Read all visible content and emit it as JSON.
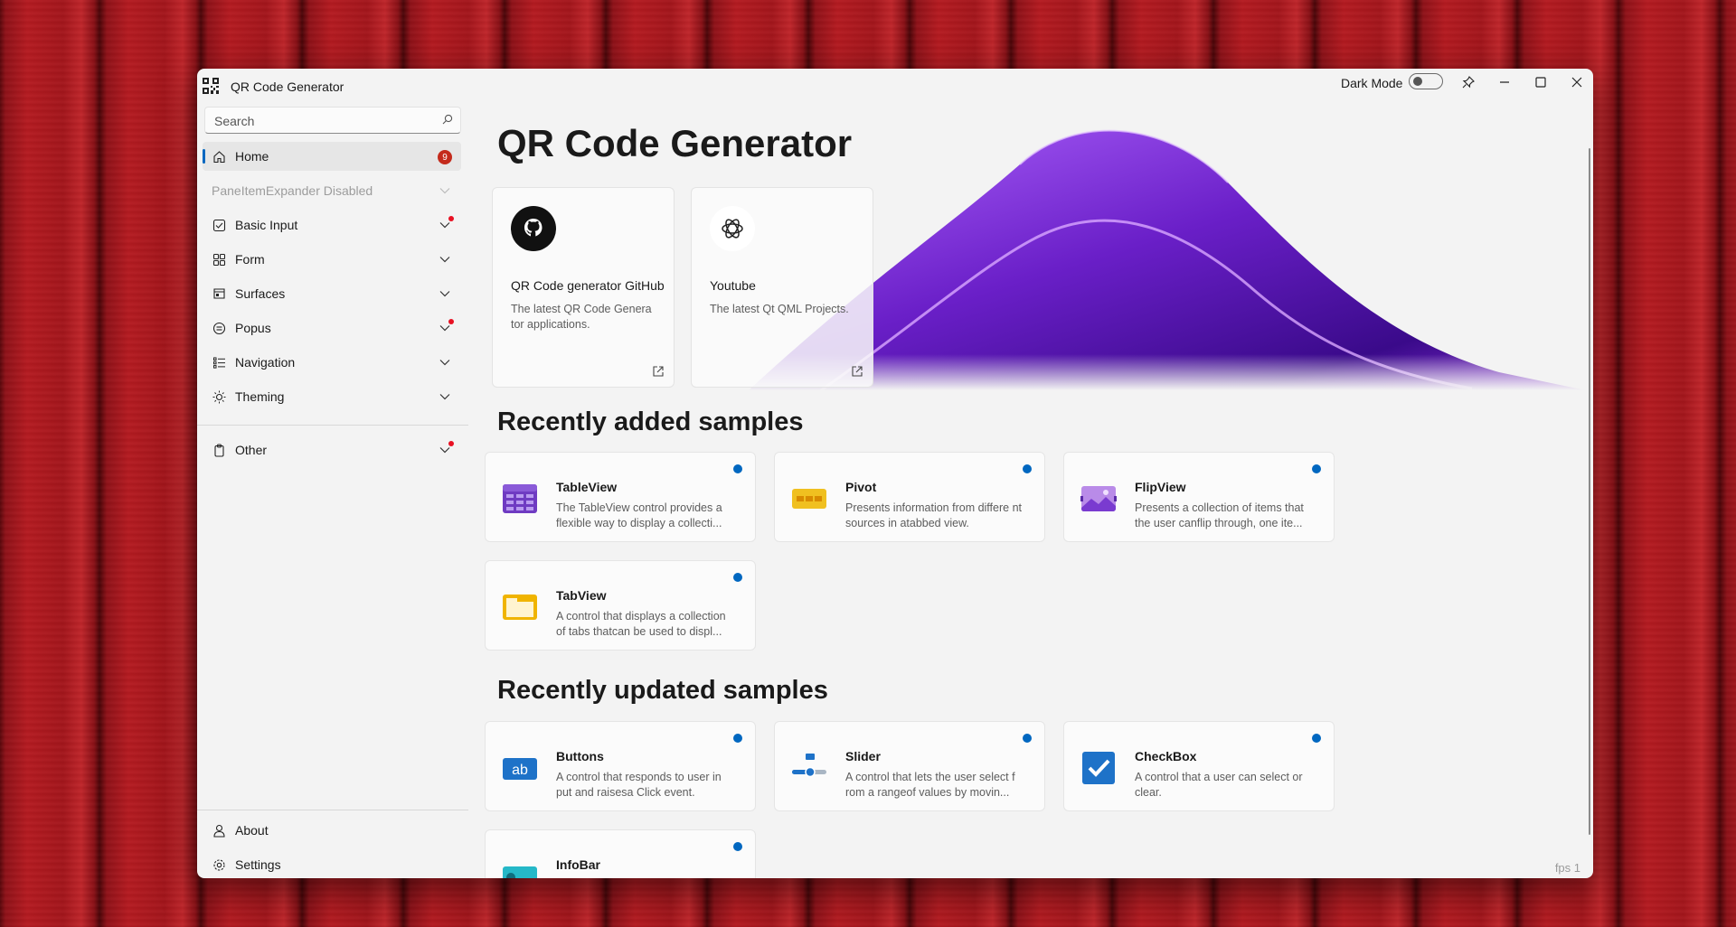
{
  "window": {
    "title": "QR Code Generator"
  },
  "titlebar": {
    "dark_mode_label": "Dark Mode",
    "dark_mode_on": false
  },
  "sidebar": {
    "search_placeholder": "Search",
    "items": [
      {
        "label": "Home",
        "icon": "home-icon",
        "badge": "9"
      },
      {
        "label": "PaneItemExpander Disabled"
      },
      {
        "label": "Basic Input",
        "icon": "checkbox-icon"
      },
      {
        "label": "Form",
        "icon": "grid-icon"
      },
      {
        "label": "Surfaces",
        "icon": "surfaces-icon"
      },
      {
        "label": "Popus",
        "icon": "popup-icon"
      },
      {
        "label": "Navigation",
        "icon": "navigation-icon"
      },
      {
        "label": "Theming",
        "icon": "sun-icon"
      },
      {
        "label": "Other",
        "icon": "clipboard-icon"
      }
    ],
    "footer": [
      {
        "label": "About",
        "icon": "person-icon"
      },
      {
        "label": "Settings",
        "icon": "settings-icon"
      }
    ]
  },
  "main": {
    "title": "QR Code Generator",
    "link_cards": [
      {
        "title": "QR Code generator GitHub",
        "desc": "The latest QR Code Genera tor applications.",
        "icon": "github-icon"
      },
      {
        "title": "Youtube",
        "desc": "The latest Qt QML Projects.",
        "icon": "openai-icon"
      }
    ],
    "recently_added_title": "Recently added samples",
    "recently_added": [
      {
        "title": "TableView",
        "desc": "The TableView control provides a flexible way to display a collecti...",
        "icon": "tableview-icon"
      },
      {
        "title": "Pivot",
        "desc": "Presents information from differe nt sources in atabbed view.",
        "icon": "pivot-icon"
      },
      {
        "title": "FlipView",
        "desc": "Presents a collection of items that the user canflip through, one ite...",
        "icon": "flipview-icon"
      },
      {
        "title": "TabView",
        "desc": "A control that displays a collection of tabs thatcan be used to displ...",
        "icon": "tabview-icon"
      }
    ],
    "recently_updated_title": "Recently updated samples",
    "recently_updated": [
      {
        "title": "Buttons",
        "desc": "A control that responds to user in put and raisesa Click event.",
        "icon": "buttons-icon",
        "icon_text": "ab"
      },
      {
        "title": "Slider",
        "desc": "A control that lets the user select f rom a rangeof values by movin...",
        "icon": "slider-icon"
      },
      {
        "title": "CheckBox",
        "desc": "A control that a user can select or clear.",
        "icon": "checkbox-sample-icon"
      },
      {
        "title": "InfoBar",
        "desc": "",
        "icon": "infobar-icon"
      }
    ]
  },
  "fps": "fps 1",
  "colors": {
    "accent": "#0067c0",
    "badge": "#c42b1c",
    "wave": "#7a2bc9"
  }
}
